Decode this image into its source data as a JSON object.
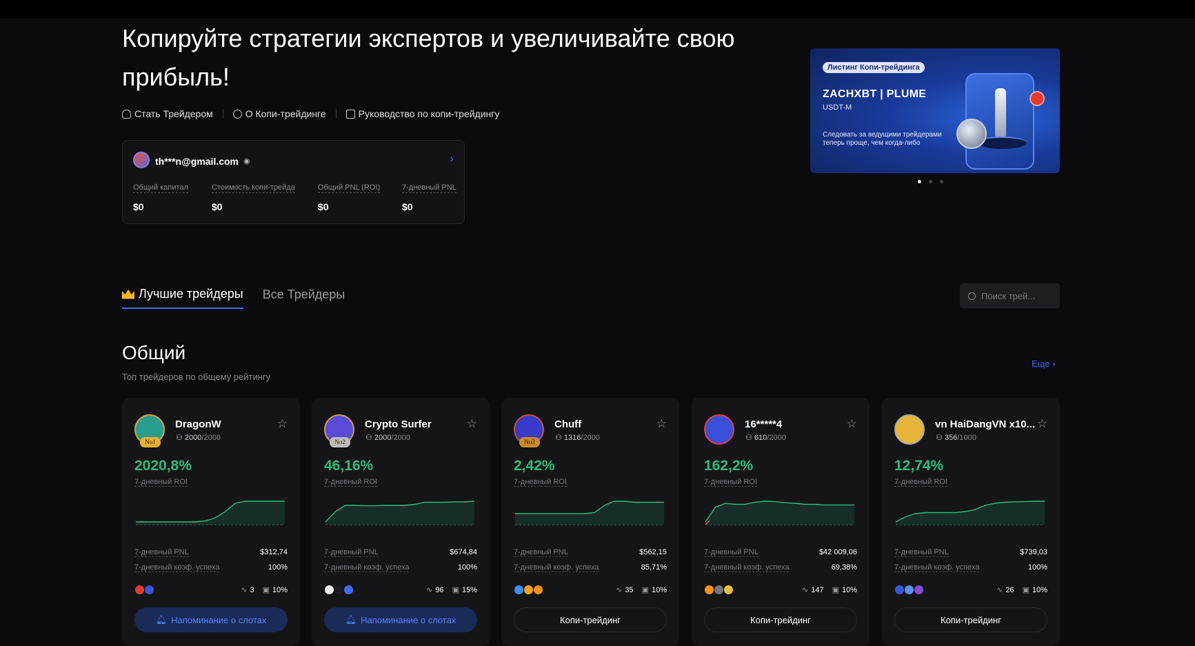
{
  "hero": {
    "title": "Копируйте стратегии экспертов и увеличивайте свою прибыль!",
    "links": [
      "Стать Трейдером",
      "О Копи-трейдинге",
      "Руководство по копи-трейдингу"
    ]
  },
  "account": {
    "email": "th***n@gmail.com",
    "stats": [
      {
        "label": "Общий капитал",
        "value": "$0"
      },
      {
        "label": "Стоимость копи-трейда",
        "value": "$0"
      },
      {
        "label": "Общий PNL (ROI)",
        "value": "$0"
      },
      {
        "label": "7-дневный PNL",
        "value": "$0"
      }
    ]
  },
  "banner": {
    "tag": "Листинг Копи-трейдинга",
    "title": "ZACHXBT | PLUME",
    "subtitle": "USDT-M",
    "desc": "Следовать за ведущими трейдерами теперь проще, чем когда-либо"
  },
  "tabs": [
    "Лучшие трейдеры",
    "Все Трейдеры"
  ],
  "search": {
    "placeholder": "Поиск трей..."
  },
  "section": {
    "title": "Общий",
    "subtitle": "Топ трейдеров по общему рейтингу",
    "more": "Еще"
  },
  "labels": {
    "roi": "7-дневный ROI",
    "pnl": "7-дневный PNL",
    "winrate": "7-дневный коэф. успеха",
    "remind": "Напоминание о слотах",
    "copy": "Копи-трейдинг"
  },
  "traders": [
    {
      "name": "DragonW",
      "rank": "No1",
      "followers": "2000",
      "max": "/2000",
      "roi": "2020,8%",
      "pnl": "$312,74",
      "winrate": "100%",
      "trades": "3",
      "share": "10%",
      "action": "remind",
      "spark": [
        0,
        0,
        0,
        0,
        0,
        0,
        0,
        0.05,
        0.2,
        0.5,
        0.9,
        1,
        1,
        1,
        1,
        1
      ]
    },
    {
      "name": "Crypto Surfer",
      "rank": "No2",
      "followers": "2000",
      "max": "/2000",
      "roi": "46,16%",
      "pnl": "$674,84",
      "winrate": "100%",
      "trades": "96",
      "share": "15%",
      "action": "remind",
      "spark": [
        0,
        0.5,
        0.8,
        0.8,
        0.78,
        0.78,
        0.8,
        0.8,
        0.8,
        0.85,
        0.95,
        0.95,
        0.95,
        0.97,
        0.97,
        1
      ]
    },
    {
      "name": "Chuff",
      "rank": "No3",
      "followers": "1316",
      "max": "/2000",
      "roi": "2,42%",
      "pnl": "$562,15",
      "winrate": "85,71%",
      "trades": "35",
      "share": "10%",
      "action": "copy",
      "spark": [
        0.4,
        0.4,
        0.4,
        0.4,
        0.4,
        0.4,
        0.4,
        0.4,
        0.45,
        0.8,
        1,
        1,
        0.95,
        0.95,
        0.95,
        0.95
      ]
    },
    {
      "name": "16*****4",
      "rank": "",
      "followers": "610",
      "max": "/2000",
      "roi": "162,2%",
      "pnl": "$42 009,06",
      "winrate": "69,38%",
      "trades": "147",
      "share": "10%",
      "action": "copy",
      "spark": [
        0,
        0.7,
        0.9,
        0.85,
        0.85,
        0.95,
        1,
        0.98,
        0.93,
        0.9,
        0.85,
        0.85,
        0.82,
        0.82,
        0.82,
        0.82
      ]
    },
    {
      "name": "vn HaiDangVN x10...",
      "rank": "",
      "followers": "356",
      "max": "/1000",
      "roi": "12,74%",
      "pnl": "$739,03",
      "winrate": "100%",
      "trades": "26",
      "share": "10%",
      "action": "copy",
      "spark": [
        0,
        0.25,
        0.4,
        0.45,
        0.45,
        0.45,
        0.45,
        0.5,
        0.6,
        0.8,
        0.9,
        0.95,
        0.97,
        0.98,
        1,
        1
      ]
    }
  ],
  "colors": {
    "accent": "#3b6cf6",
    "positive": "#2bbd7e",
    "negative": "#e04040"
  }
}
